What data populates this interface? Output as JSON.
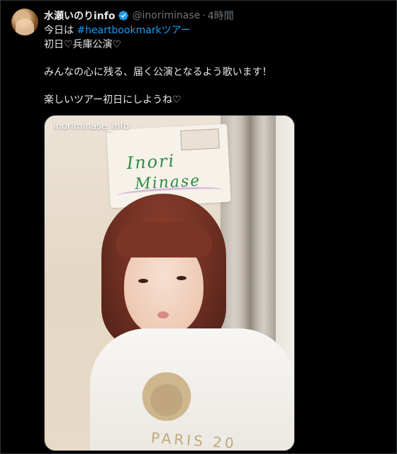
{
  "post": {
    "author": {
      "display_name": "水瀬いのりinfo",
      "handle": "@inoriminase",
      "separator": "·",
      "time": "4時間",
      "verified_icon": "verified-badge-icon"
    },
    "text": {
      "line1_prefix": "今日は ",
      "hashtag": "#heartbookmarkツアー",
      "line2": "初日♡兵庫公演♡",
      "line3": "みんなの心に残る、届く公演となるよう歌います！",
      "line4": "楽しいツアー初日にしようね♡"
    },
    "media": {
      "watermark": "inoriminase_info",
      "sign_line1": "Inori",
      "sign_line2": "Minase",
      "shirt_text": "PARIS 20"
    }
  },
  "colors": {
    "background": "#000000",
    "text": "#e7e9ea",
    "muted": "#71767b",
    "link": "#1d9bf0",
    "verified": "#1d9bf0"
  }
}
